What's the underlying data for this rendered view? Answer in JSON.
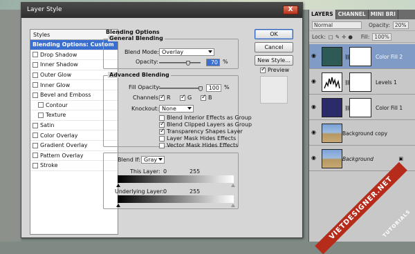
{
  "dialog": {
    "title": "Layer Style",
    "close_label": "X",
    "styles_header": "Styles",
    "style_items": [
      {
        "label": "Blending Options: Custom",
        "checkbox": false,
        "indent": false,
        "selected": true
      },
      {
        "label": "Drop Shadow",
        "checkbox": true,
        "indent": false,
        "selected": false
      },
      {
        "label": "Inner Shadow",
        "checkbox": true,
        "indent": false,
        "selected": false
      },
      {
        "label": "Outer Glow",
        "checkbox": true,
        "indent": false,
        "selected": false
      },
      {
        "label": "Inner Glow",
        "checkbox": true,
        "indent": false,
        "selected": false
      },
      {
        "label": "Bevel and Emboss",
        "checkbox": true,
        "indent": false,
        "selected": false
      },
      {
        "label": "Contour",
        "checkbox": true,
        "indent": true,
        "selected": false
      },
      {
        "label": "Texture",
        "checkbox": true,
        "indent": true,
        "selected": false
      },
      {
        "label": "Satin",
        "checkbox": true,
        "indent": false,
        "selected": false
      },
      {
        "label": "Color Overlay",
        "checkbox": true,
        "indent": false,
        "selected": false
      },
      {
        "label": "Gradient Overlay",
        "checkbox": true,
        "indent": false,
        "selected": false
      },
      {
        "label": "Pattern Overlay",
        "checkbox": true,
        "indent": false,
        "selected": false
      },
      {
        "label": "Stroke",
        "checkbox": true,
        "indent": false,
        "selected": false
      }
    ],
    "blending_title": "Blending Options",
    "general": {
      "title": "General Blending",
      "blend_mode_label": "Blend Mode:",
      "blend_mode_value": "Overlay",
      "opacity_label": "Opacity:",
      "opacity_value": "70",
      "opacity_unit": "%",
      "opacity_level": 0.7
    },
    "advanced": {
      "title": "Advanced Blending",
      "fill_opacity_label": "Fill Opacity:",
      "fill_opacity_value": "100",
      "fill_opacity_unit": "%",
      "fill_opacity_level": 1.0,
      "channels_label": "Channels:",
      "channels": [
        {
          "label": "R",
          "checked": true
        },
        {
          "label": "G",
          "checked": true
        },
        {
          "label": "B",
          "checked": true
        }
      ],
      "knockout_label": "Knockout:",
      "knockout_value": "None",
      "options": [
        {
          "label": "Blend Interior Effects as Group",
          "checked": false
        },
        {
          "label": "Blend Clipped Layers as Group",
          "checked": true
        },
        {
          "label": "Transparency Shapes Layer",
          "checked": true
        },
        {
          "label": "Layer Mask Hides Effects",
          "checked": false
        },
        {
          "label": "Vector Mask Hides Effects",
          "checked": false
        }
      ]
    },
    "blend_if": {
      "label": "Blend If:",
      "value": "Gray",
      "this_layer_label": "This Layer:",
      "this_layer_min": "0",
      "this_layer_max": "255",
      "underlying_label": "Underlying Layer:",
      "underlying_min": "0",
      "underlying_max": "255"
    },
    "buttons": {
      "ok": "OK",
      "cancel": "Cancel",
      "new_style": "New Style...",
      "preview": "Preview"
    }
  },
  "layers_panel": {
    "tabs": [
      "LAYERS",
      "CHANNEL",
      "MINI BRI"
    ],
    "blend_mode": "Normal",
    "opacity_label": "Opacity:",
    "opacity_value": "20%",
    "lock_label": "Lock:",
    "fill_label": "Fill:",
    "fill_value": "100%",
    "layers": [
      {
        "name": "Color Fill 2",
        "type": "color-fill",
        "color": "#2e5a56",
        "selected": true,
        "italic": false
      },
      {
        "name": "Levels 1",
        "type": "adjustment",
        "color": "#ffffff",
        "selected": false,
        "italic": false
      },
      {
        "name": "Color Fill 1",
        "type": "color-fill",
        "color": "#2b2b6a",
        "selected": false,
        "italic": false
      },
      {
        "name": "Background copy",
        "type": "photo",
        "color": "#6f8fbf",
        "selected": false,
        "italic": false
      },
      {
        "name": "Background",
        "type": "photo",
        "color": "#6f8fbf",
        "selected": false,
        "italic": true
      }
    ]
  },
  "watermark": {
    "site": "VIETDESIGNER.NET",
    "sub": "TUTORIALS"
  },
  "colors": {
    "selection": "#3a6fd0",
    "titlebar": "#333333",
    "close": "#c4442b",
    "panel_selection": "#7f9bc6"
  }
}
